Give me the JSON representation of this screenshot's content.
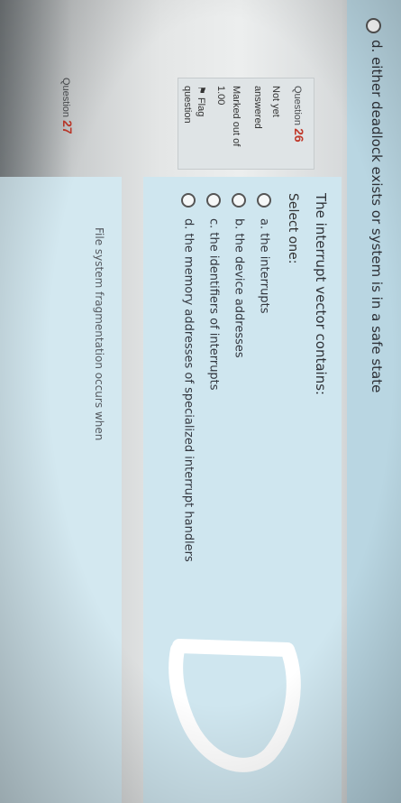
{
  "previous_question": {
    "option_d": "d. either deadlock exists or system is in a safe state"
  },
  "question_26": {
    "label": "Question",
    "number": "26",
    "status_line1": "Not yet",
    "status_line2": "answered",
    "marked_line1": "Marked out of",
    "marked_line2": "1.00",
    "flag_line1": "Flag",
    "flag_line2": "question",
    "text": "The interrupt vector contains:",
    "instruction": "Select one:",
    "options": [
      "a. the interrupts",
      "b. the device addresses",
      "c. the identifiers of interrupts",
      "d. the memory addresses of specialized interrupt handlers"
    ]
  },
  "question_27": {
    "label": "Question",
    "number": "27",
    "text": "File system fragmentation occurs when"
  },
  "icons": {
    "flag": "flag-icon",
    "radio": "radio-button-icon",
    "handwriting": "handwritten-d-mark"
  },
  "colors": {
    "question_number": "#c0392b",
    "content_bg": "#cfe6ef",
    "info_bg": "#dfe4e6"
  }
}
